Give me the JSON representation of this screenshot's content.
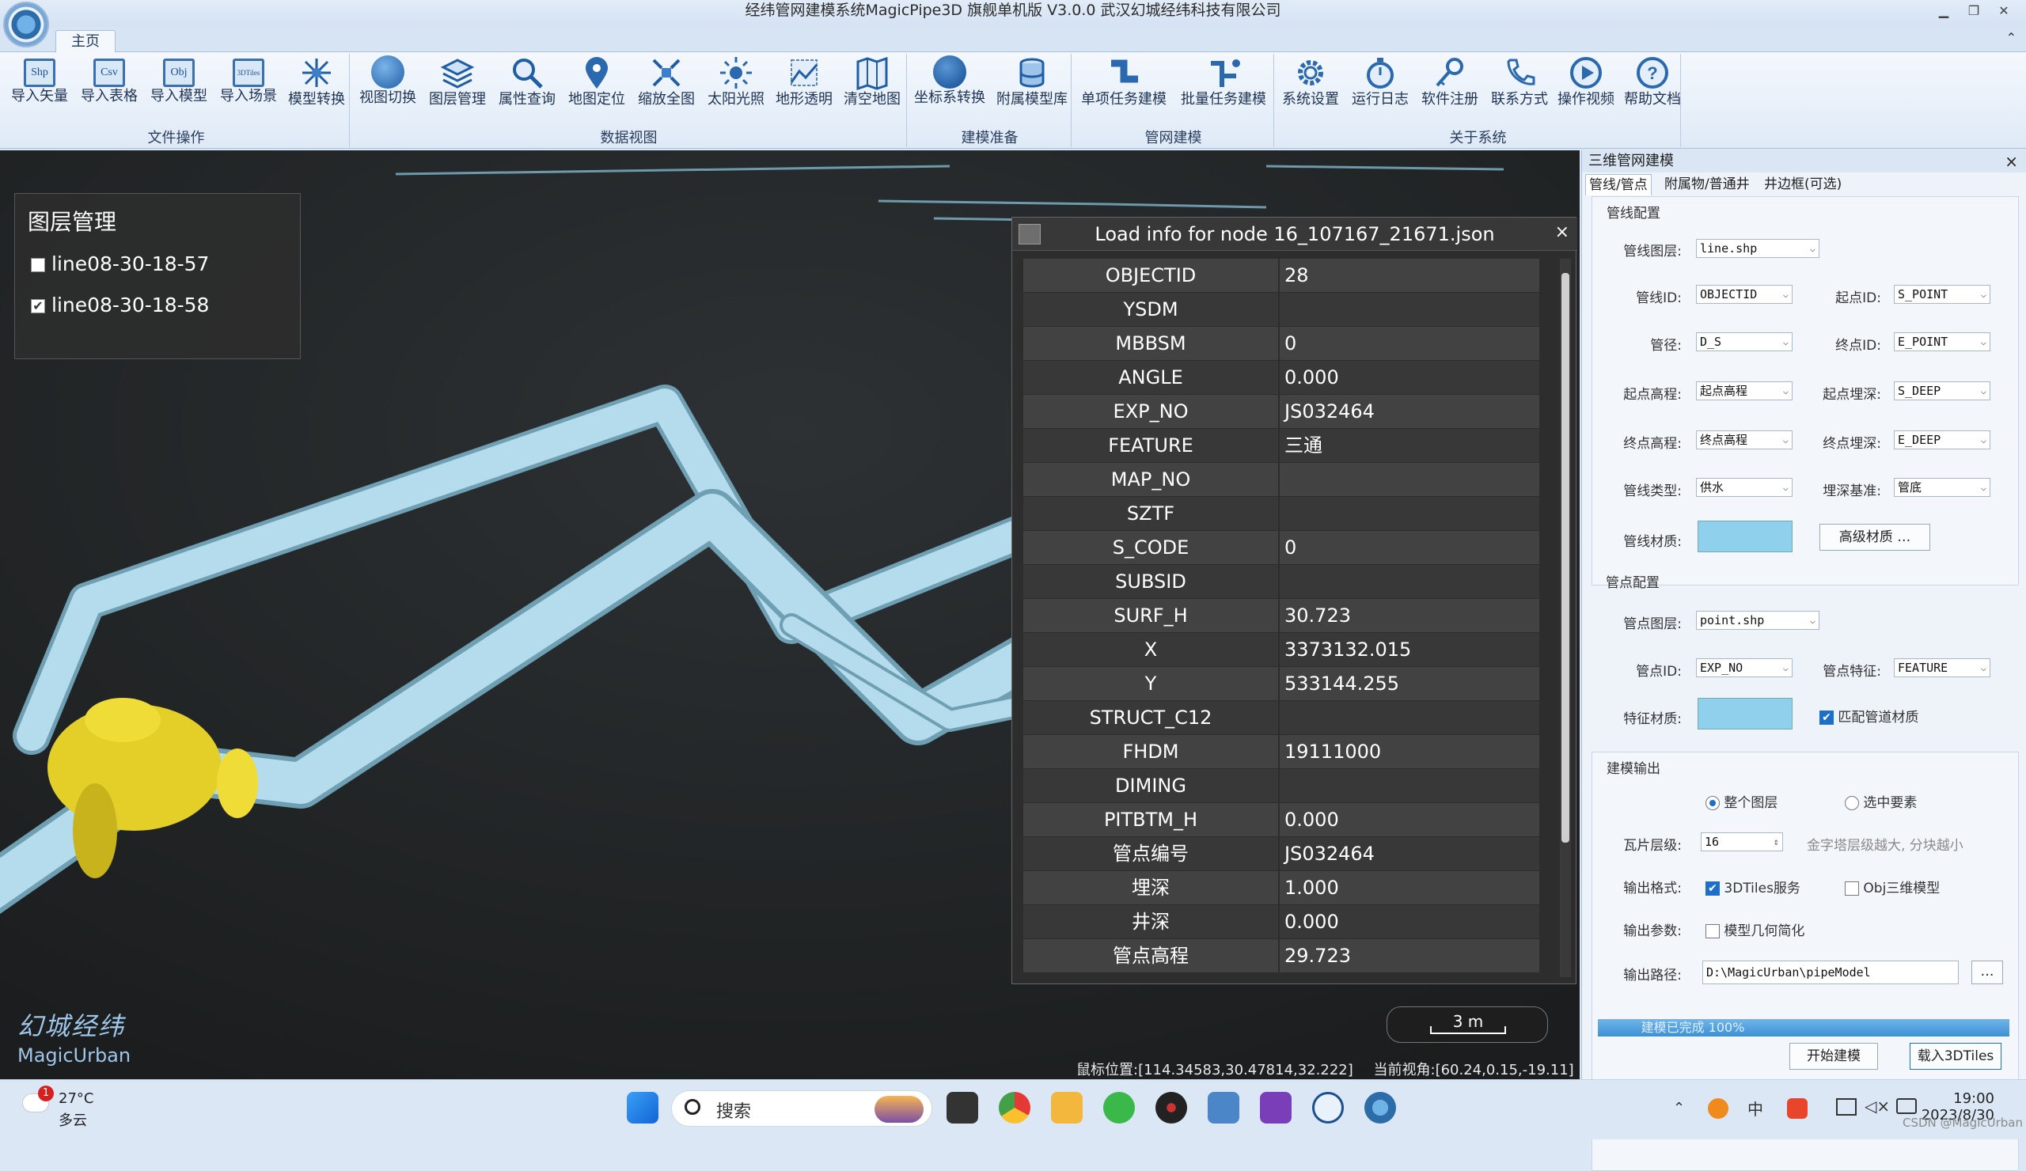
{
  "window": {
    "title": "经纬管网建模系统MagicPipe3D   旗舰单机版 V3.0.0      武汉幻城经纬科技有限公司",
    "controls": [
      "▁",
      "❐",
      "✕"
    ]
  },
  "tabs": {
    "home": "主页"
  },
  "ribbon": {
    "groups": [
      {
        "label": "文件操作",
        "buttons": [
          "导入矢量",
          "导入表格",
          "导入模型",
          "导入场景",
          "模型转换"
        ]
      },
      {
        "label": "数据视图",
        "buttons": [
          "视图切换",
          "图层管理",
          "属性查询",
          "地图定位",
          "缩放全图",
          "太阳光照",
          "地形透明",
          "清空地图"
        ]
      },
      {
        "label": "建模准备",
        "buttons": [
          "坐标系转换",
          "附属模型库"
        ]
      },
      {
        "label": "管网建模",
        "buttons": [
          "单项任务建模",
          "批量任务建模"
        ]
      },
      {
        "label": "关于系统",
        "buttons": [
          "系统设置",
          "运行日志",
          "软件注册",
          "联系方式",
          "操作视频",
          "帮助文档"
        ]
      }
    ],
    "icon_badges": {
      "shp": "Shp",
      "csv": "Csv",
      "obj": "Obj",
      "tiles": "3DTiles"
    }
  },
  "layer_panel": {
    "title": "图层管理",
    "layers": [
      {
        "name": "line08-30-18-57",
        "checked": false
      },
      {
        "name": "line08-30-18-58",
        "checked": true
      }
    ]
  },
  "brand": {
    "cn": "幻城经纬",
    "en": "MagicUrban"
  },
  "scale": "3 m",
  "status": {
    "mouse": "鼠标位置:[114.34583,30.47814,32.222]",
    "view": "当前视角:[60.24,0.15,-19.11]"
  },
  "info_dialog": {
    "title": "Load info for node 16_107167_21671.json",
    "close": "×",
    "rows": [
      {
        "key": "OBJECTID",
        "value": "28"
      },
      {
        "key": "YSDM",
        "value": ""
      },
      {
        "key": "MBBSM",
        "value": "0"
      },
      {
        "key": "ANGLE",
        "value": "0.000"
      },
      {
        "key": "EXP_NO",
        "value": "JS032464"
      },
      {
        "key": "FEATURE",
        "value": "三通"
      },
      {
        "key": "MAP_NO",
        "value": ""
      },
      {
        "key": "SZTF",
        "value": ""
      },
      {
        "key": "S_CODE",
        "value": "0"
      },
      {
        "key": "SUBSID",
        "value": ""
      },
      {
        "key": "SURF_H",
        "value": "30.723"
      },
      {
        "key": "X",
        "value": "3373132.015"
      },
      {
        "key": "Y",
        "value": "533144.255"
      },
      {
        "key": "STRUCT_C12",
        "value": ""
      },
      {
        "key": "FHDM",
        "value": "19111000"
      },
      {
        "key": "DIMING",
        "value": ""
      },
      {
        "key": "PITBTM_H",
        "value": "0.000"
      },
      {
        "key": "管点编号",
        "value": "JS032464"
      },
      {
        "key": "埋深",
        "value": "1.000"
      },
      {
        "key": "井深",
        "value": "0.000"
      },
      {
        "key": "管点高程",
        "value": "29.723"
      }
    ]
  },
  "right_panel": {
    "title": "三维管网建模",
    "close": "×",
    "tabs": [
      "管线/管点",
      "附属物/普通井",
      "井边框(可选)"
    ],
    "line_config": {
      "title": "管线配置",
      "layer_label": "管线图层:",
      "layer_value": "line.shp",
      "id_label": "管线ID:",
      "id_value": "OBJECTID",
      "start_id_label": "起点ID:",
      "start_id_value": "S_POINT",
      "diam_label": "管径:",
      "diam_value": "D_S",
      "end_id_label": "终点ID:",
      "end_id_value": "E_POINT",
      "start_elev_label": "起点高程:",
      "start_elev_value": "起点高程",
      "start_depth_label": "起点埋深:",
      "start_depth_value": "S_DEEP",
      "end_elev_label": "终点高程:",
      "end_elev_value": "终点高程",
      "end_depth_label": "终点埋深:",
      "end_depth_value": "E_DEEP",
      "type_label": "管线类型:",
      "type_value": "供水",
      "depth_base_label": "埋深基准:",
      "depth_base_value": "管底",
      "material_label": "管线材质:",
      "advanced_btn": "高级材质 …",
      "material_color": "#8fd1ec"
    },
    "point_config": {
      "title": "管点配置",
      "layer_label": "管点图层:",
      "layer_value": "point.shp",
      "id_label": "管点ID:",
      "id_value": "EXP_NO",
      "feature_label": "管点特征:",
      "feature_value": "FEATURE",
      "material_label": "特征材质:",
      "match_label": "匹配管道材质",
      "material_color": "#8fd1ec"
    },
    "output": {
      "title": "建模输出",
      "radio_all": "整个图层",
      "radio_selected": "选中要素",
      "tile_label": "瓦片层级:",
      "tile_value": "16",
      "tile_hint": "金字塔层级越大, 分块越小",
      "format_label": "输出格式:",
      "fmt_3dtiles": "3DTiles服务",
      "fmt_obj": "Obj三维模型",
      "param_label": "输出参数:",
      "simplify": "模型几何简化",
      "path_label": "输出路径:",
      "path_value": "D:\\MagicUrban\\pipeModel",
      "browse": "…"
    },
    "progress_text": "建模已完成  100%",
    "progress": 1.0,
    "start_btn": "开始建模",
    "load_btn": "载入3DTiles"
  },
  "taskbar": {
    "weather_temp": "27°C",
    "weather_desc": "多云",
    "weather_badge": "1",
    "search": "搜索",
    "time": "19:00",
    "date": "2023/8/30",
    "watermark": "CSDN @MagicUrban"
  },
  "colors": {
    "pipe": "#a9d8ea",
    "junction": "#e8d22a",
    "accent": "#1f6fc8"
  }
}
